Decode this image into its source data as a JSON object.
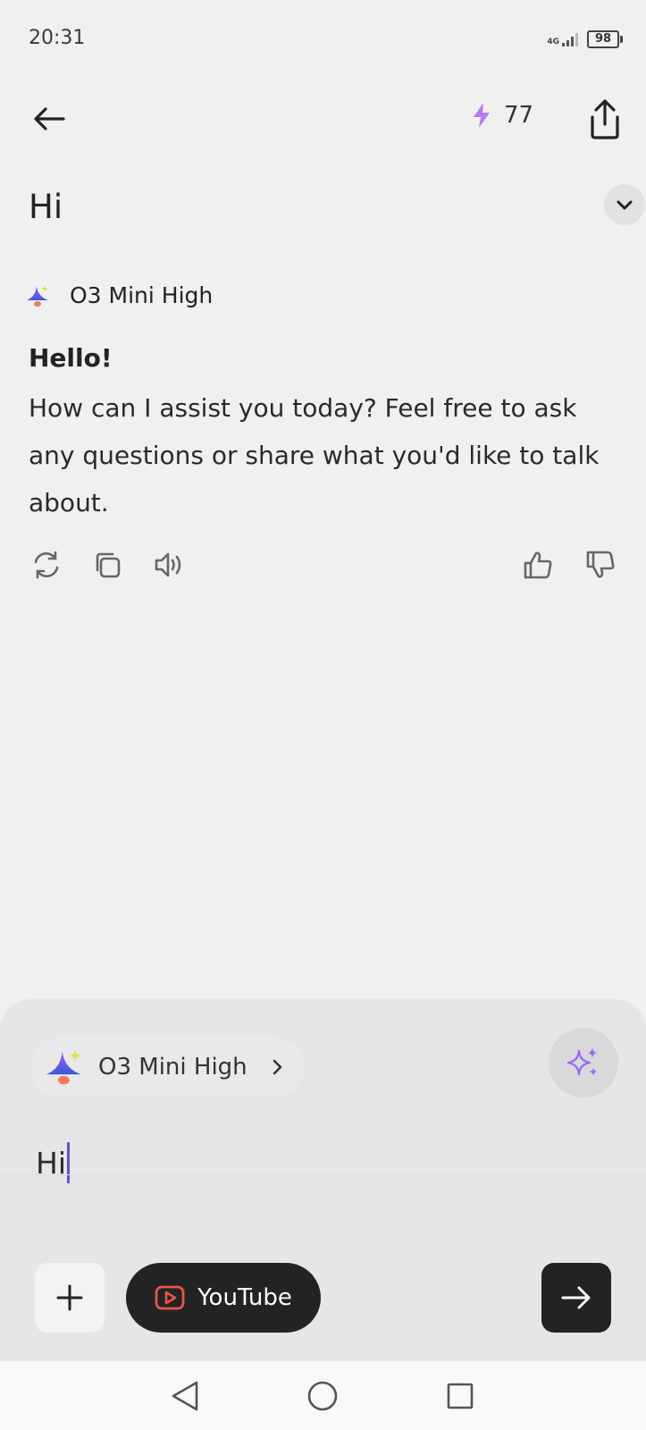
{
  "status": {
    "time": "20:31",
    "network": "4G",
    "battery": "98"
  },
  "header": {
    "credits": "77",
    "back_icon": "arrow-left-icon",
    "share_icon": "share-icon",
    "credits_icon": "lightning-icon"
  },
  "chat": {
    "title": "Hi",
    "model_name": "O3 Mini High",
    "message_bold": "Hello!",
    "message_body": "How can I assist you today? Feel free to ask any questions or share what you'd like to talk about."
  },
  "composer": {
    "model_label": "O3 Mini High",
    "input_value": "Hi",
    "youtube_label": "YouTube"
  },
  "colors": {
    "accent": "#9b6bf2",
    "youtube_red": "#e8544f",
    "dark_button": "#232323",
    "background": "#f0f0f1"
  }
}
